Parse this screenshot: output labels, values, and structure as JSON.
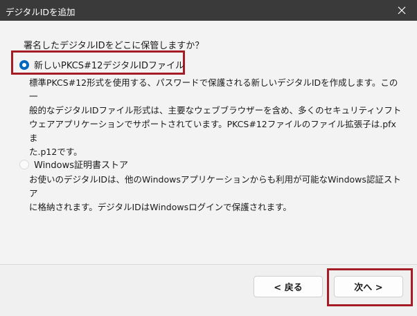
{
  "window": {
    "title": "デジタルIDを追加",
    "close_icon": "close-icon"
  },
  "main": {
    "question": "署名したデジタルIDをどこに保管しますか？",
    "options": [
      {
        "label": "新しいPKCS#12デジタルIDファイル",
        "selected": true,
        "description": [
          "標準PKCS#12形式を使用する、パスワードで保護される新しいデジタルIDを作成します。この一",
          "般的なデジタルIDファイル形式は、主要なウェブブラウザーを含め、多くのセキュリティソフト",
          "ウェアアプリケーションでサポートされています。PKCS#12ファイルのファイル拡張子は.pfxま",
          "た.p12です。"
        ]
      },
      {
        "label": "Windows証明書ストア",
        "selected": false,
        "description": [
          "お使いのデジタルIDは、他のWindowsアプリケーションからも利用が可能なWindows認証ストア",
          "に格納されます。デジタルIDはWindowsログインで保護されます。"
        ]
      }
    ]
  },
  "footer": {
    "back_label": "< 戻る",
    "next_label": "次へ >"
  },
  "colors": {
    "accent": "#0067c0",
    "highlight_frame": "#a61c24",
    "titlebar": "#3a3a3a"
  }
}
